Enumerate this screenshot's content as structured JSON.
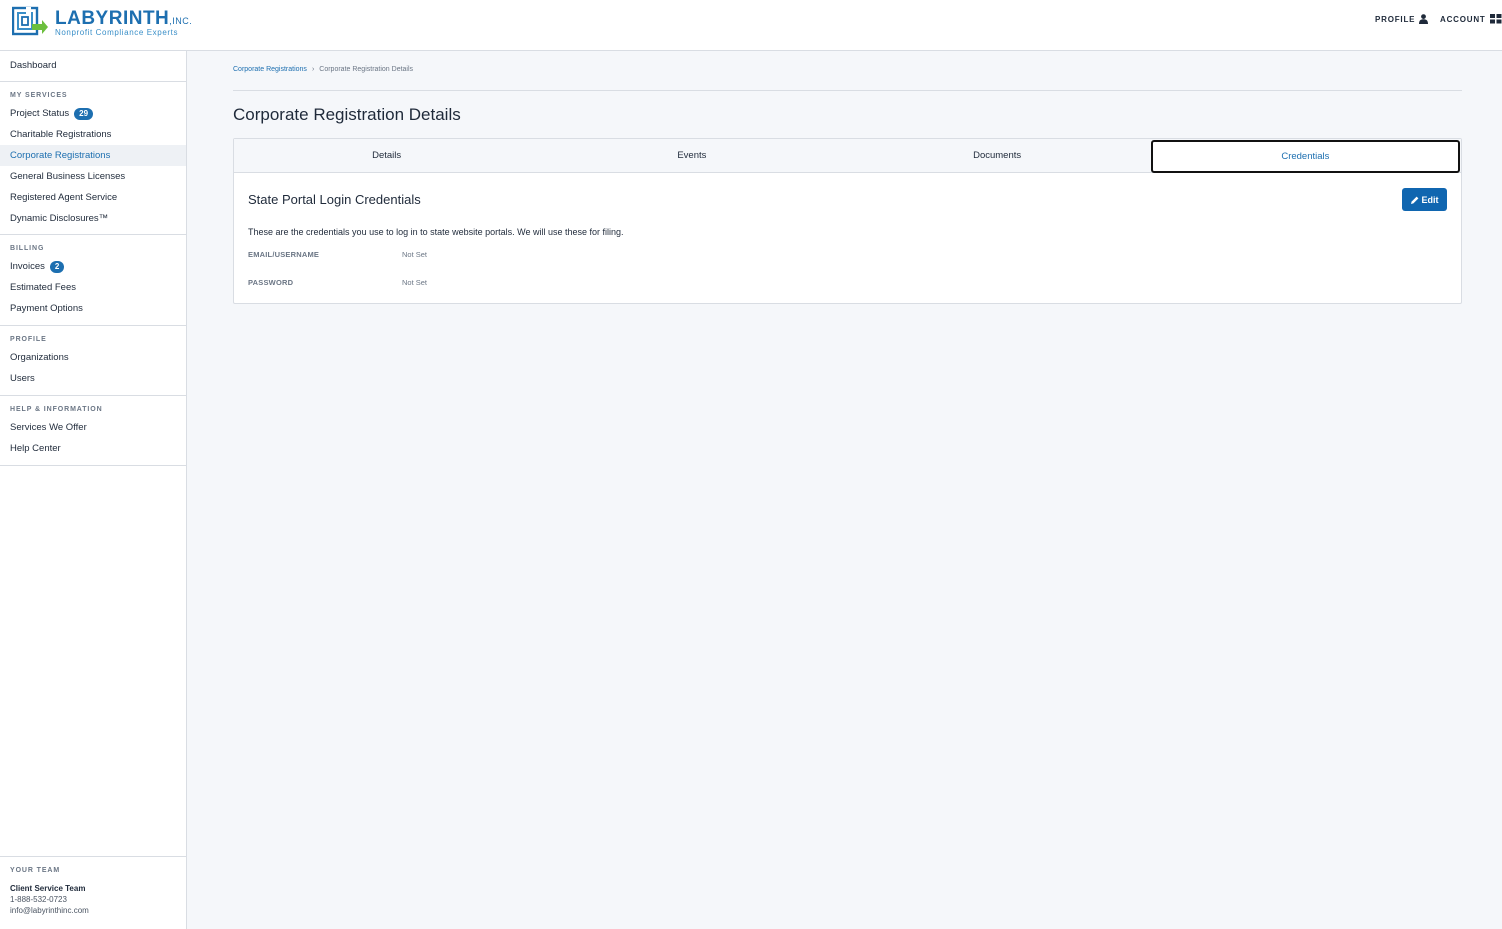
{
  "brand": {
    "name": "LABYRINTH",
    "suffix": ",INC.",
    "tagline": "Nonprofit Compliance Experts",
    "color": "#1d6fb0"
  },
  "header": {
    "profile_label": "PROFILE",
    "account_label": "ACCOUNT"
  },
  "sidebar": {
    "dashboard": "Dashboard",
    "my_services": {
      "heading": "MY SERVICES",
      "items": [
        {
          "label": "Project Status",
          "badge": "29"
        },
        {
          "label": "Charitable Registrations"
        },
        {
          "label": "Corporate Registrations",
          "active": true
        },
        {
          "label": "General Business Licenses"
        },
        {
          "label": "Registered Agent Service"
        },
        {
          "label": "Dynamic Disclosures™"
        }
      ]
    },
    "billing": {
      "heading": "BILLING",
      "items": [
        {
          "label": "Invoices",
          "badge": "2"
        },
        {
          "label": "Estimated Fees"
        },
        {
          "label": "Payment Options"
        }
      ]
    },
    "profile": {
      "heading": "PROFILE",
      "items": [
        {
          "label": "Organizations"
        },
        {
          "label": "Users"
        }
      ]
    },
    "help": {
      "heading": "HELP & INFORMATION",
      "items": [
        {
          "label": "Services We Offer"
        },
        {
          "label": "Help Center"
        }
      ]
    },
    "team": {
      "heading": "YOUR TEAM",
      "name": "Client Service Team",
      "phone": "1-888-532-0723",
      "email": "info@labyrinthinc.com"
    }
  },
  "breadcrumb": {
    "parent": "Corporate Registrations",
    "separator": "›",
    "current": "Corporate Registration Details"
  },
  "page": {
    "title": "Corporate Registration Details"
  },
  "tabs": [
    {
      "label": "Details"
    },
    {
      "label": "Events"
    },
    {
      "label": "Documents"
    },
    {
      "label": "Credentials",
      "active": true
    }
  ],
  "credentials": {
    "title": "State Portal Login Credentials",
    "edit_label": "Edit",
    "description": "These are the credentials you use to log in to state website portals. We will use these for filing.",
    "fields": [
      {
        "label": "EMAIL/USERNAME",
        "value": "Not Set"
      },
      {
        "label": "PASSWORD",
        "value": "Not Set"
      }
    ]
  },
  "icons": {
    "profile": "user-icon",
    "account": "grid-icon",
    "edit": "pencil-icon"
  }
}
